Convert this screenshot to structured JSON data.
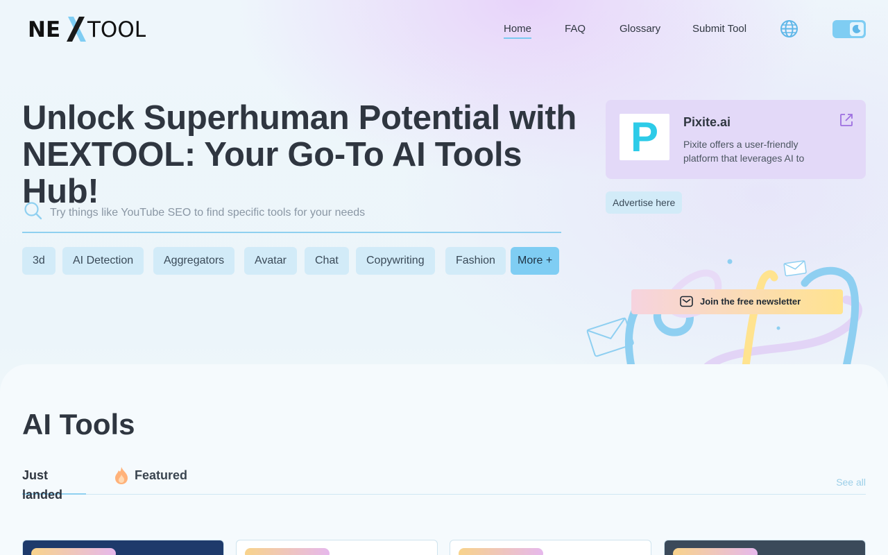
{
  "brand": {
    "logo_text": "NEXTOOL"
  },
  "nav": {
    "items": [
      {
        "label": "Home",
        "active": true
      },
      {
        "label": "FAQ"
      },
      {
        "label": "Glossary"
      },
      {
        "label": "Submit Tool"
      }
    ],
    "language_icon": "globe-icon",
    "theme_toggle_icon": "moon-icon"
  },
  "hero": {
    "title": "Unlock Superhuman Potential with NEXTOOL: Your Go-To AI Tools Hub!",
    "search_placeholder": "Try things like YouTube SEO to find specific tools for your needs",
    "chips": [
      "3d",
      "AI Detection",
      "Aggregators",
      "Avatar",
      "Chat",
      "Copywriting",
      "Fashion",
      "More +"
    ]
  },
  "ad": {
    "logo_letter": "P",
    "name": "Pixite.ai",
    "description": "Pixite offers a user-friendly platform that leverages AI to",
    "advertise_label": "Advertise here",
    "external_icon": "external-link-icon"
  },
  "newsletter": {
    "label": "Join the free newsletter",
    "icon": "mail-icon"
  },
  "tools": {
    "title": "AI Tools",
    "tabs": [
      {
        "label": "Just landed",
        "active": true
      },
      {
        "label": "Featured",
        "icon": "flame-icon"
      }
    ],
    "see_all": "See all"
  },
  "colors": {
    "accent": "#7fcdf3",
    "chip_bg": "#d2ebf8",
    "ad_bg": "#e3d9f8",
    "text": "#2f3640",
    "logo_x": "#7fcdf3"
  }
}
